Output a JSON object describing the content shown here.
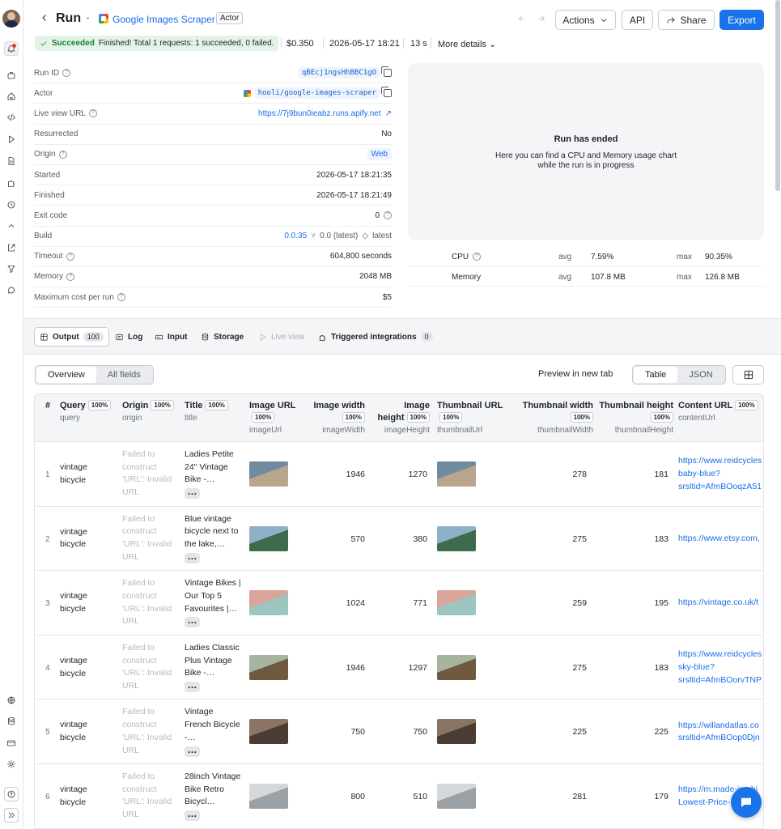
{
  "header": {
    "title": "Run",
    "actor_name": "Google Images Scraper",
    "actor_badge": "Actor",
    "buttons": {
      "actions": "Actions",
      "api": "API",
      "share": "Share",
      "export": "Export"
    }
  },
  "status": {
    "label": "Succeeded",
    "message": "Finished! Total 1 requests: 1 succeeded, 0 failed.",
    "cost": "$0.350",
    "datetime": "2026-05-17 18:21",
    "duration": "13 s",
    "more": "More details"
  },
  "details": [
    {
      "label": "Run ID",
      "value": "qBEcj1ngsHhBBC1gO",
      "kind": "code"
    },
    {
      "label": "Actor",
      "value": "hooli/google-images-scraper",
      "kind": "actor"
    },
    {
      "label": "Live view URL",
      "value": "https://7j9bun0ieabz.runs.apify.net",
      "kind": "link"
    },
    {
      "label": "Resurrected",
      "value": "No",
      "kind": "text"
    },
    {
      "label": "Origin",
      "value": "Web",
      "kind": "tag"
    },
    {
      "label": "Started",
      "value": "2026-05-17 18:21:35",
      "kind": "text"
    },
    {
      "label": "Finished",
      "value": "2026-05-17 18:21:49",
      "kind": "text"
    },
    {
      "label": "Exit code",
      "value": "0",
      "kind": "text"
    },
    {
      "label": "Build",
      "value": "0.0.35",
      "kind": "build",
      "build_tag": "0.0 (latest)",
      "label2": "latest"
    },
    {
      "label": "Timeout",
      "value": "604,800 seconds",
      "kind": "text"
    },
    {
      "label": "Memory",
      "value": "2048 MB",
      "kind": "text"
    },
    {
      "label": "Maximum cost per run",
      "value": "$5",
      "kind": "text"
    }
  ],
  "chart_panel": {
    "title": "Run has ended",
    "subtitle": "Here you can find a CPU and Memory usage chart while the run is in progress"
  },
  "resources": [
    {
      "name": "CPU",
      "avg_label": "avg",
      "avg": "7.59%",
      "max_label": "max",
      "max": "90.35%"
    },
    {
      "name": "Memory",
      "avg_label": "avg",
      "avg": "107.8 MB",
      "max_label": "max",
      "max": "126.8 MB"
    }
  ],
  "tabs": [
    {
      "label": "Output",
      "count": "100"
    },
    {
      "label": "Log"
    },
    {
      "label": "Input"
    },
    {
      "label": "Storage"
    },
    {
      "label": "Live view"
    },
    {
      "label": "Triggered integrations",
      "count": "0"
    }
  ],
  "view": {
    "overview": "Overview",
    "all_fields": "All fields",
    "preview": "Preview in new tab",
    "table": "Table",
    "json": "JSON"
  },
  "columns": [
    {
      "name": "#"
    },
    {
      "name": "Query",
      "pct": "100%",
      "field": "query"
    },
    {
      "name": "Origin",
      "pct": "100%",
      "field": "origin"
    },
    {
      "name": "Title",
      "pct": "100%",
      "field": "title"
    },
    {
      "name": "Image URL",
      "pct": "100%",
      "field": "imageUrl"
    },
    {
      "name": "Image width",
      "pct": "100%",
      "field": "imageWidth"
    },
    {
      "name": "Image height",
      "pct": "100%",
      "field": "imageHeight"
    },
    {
      "name": "Thumbnail URL",
      "pct": "100%",
      "field": "thumbnailUrl"
    },
    {
      "name": "Thumbnail width",
      "pct": "100%",
      "field": "thumbnailWidth"
    },
    {
      "name": "Thumbnail height",
      "pct": "100%",
      "field": "thumbnailHeight"
    },
    {
      "name": "Content URL",
      "pct": "100%",
      "field": "contentUrl"
    }
  ],
  "rows": [
    {
      "num": "1",
      "query": "vintage bicycle",
      "origin": "Failed to construct 'URL': Invalid URL",
      "title": "Ladies Petite 24\" Vintage Bike -…",
      "iw": "1946",
      "ih": "1270",
      "tw": "278",
      "th": "181",
      "content": "https://www.reidcycles\nbaby-blue?\nsrsltid=AfmBOoqzA51",
      "c1": "#b9a58c",
      "c2": "#6f8aa1"
    },
    {
      "num": "2",
      "query": "vintage bicycle",
      "origin": "Failed to construct 'URL': Invalid URL",
      "title": "Blue vintage bicycle next to the lake,…",
      "iw": "570",
      "ih": "380",
      "tw": "275",
      "th": "183",
      "content": "https://www.etsy.com,",
      "c1": "#3f6b4d",
      "c2": "#8fb1c8"
    },
    {
      "num": "3",
      "query": "vintage bicycle",
      "origin": "Failed to construct 'URL': Invalid URL",
      "title": "Vintage Bikes | Our Top 5 Favourites |…",
      "iw": "1024",
      "ih": "771",
      "tw": "259",
      "th": "195",
      "content": "https://vintage.co.uk/t",
      "c1": "#9dc6c0",
      "c2": "#d9a59b"
    },
    {
      "num": "4",
      "query": "vintage bicycle",
      "origin": "Failed to construct 'URL': Invalid URL",
      "title": "Ladies Classic Plus Vintage Bike -…",
      "iw": "1946",
      "ih": "1297",
      "tw": "275",
      "th": "183",
      "content": "https://www.reidcycles\nsky-blue?\nsrsltid=AfmBOorvTNP",
      "c1": "#6e5a3f",
      "c2": "#a6b4a0"
    },
    {
      "num": "5",
      "query": "vintage bicycle",
      "origin": "Failed to construct 'URL': Invalid URL",
      "title": "Vintage French Bicycle -…",
      "iw": "750",
      "ih": "750",
      "tw": "225",
      "th": "225",
      "content": "https://willandatlas.co\nsrsltid=AfmBOop0Djn",
      "c1": "#4a3b33",
      "c2": "#8a7463"
    },
    {
      "num": "6",
      "query": "vintage bicycle",
      "origin": "Failed to construct 'URL': Invalid URL",
      "title": "28inch Vintage Bike Retro Bicycl…",
      "iw": "800",
      "ih": "510",
      "tw": "281",
      "th": "179",
      "content": "https://m.made-in-chi\nLowest-Price-…B",
      "c1": "#9aa0a4",
      "c2": "#d5d8da"
    }
  ],
  "icons": [
    "bell-icon",
    "briefcase-icon",
    "home-icon",
    "code-icon",
    "play-icon",
    "file-icon",
    "puzzle-icon",
    "clock-icon",
    "chevron-up-icon",
    "share-icon",
    "filter-icon",
    "chat-icon",
    "globe-icon",
    "database-icon",
    "card-icon",
    "gear-icon",
    "help-icon",
    "expand-icon"
  ]
}
